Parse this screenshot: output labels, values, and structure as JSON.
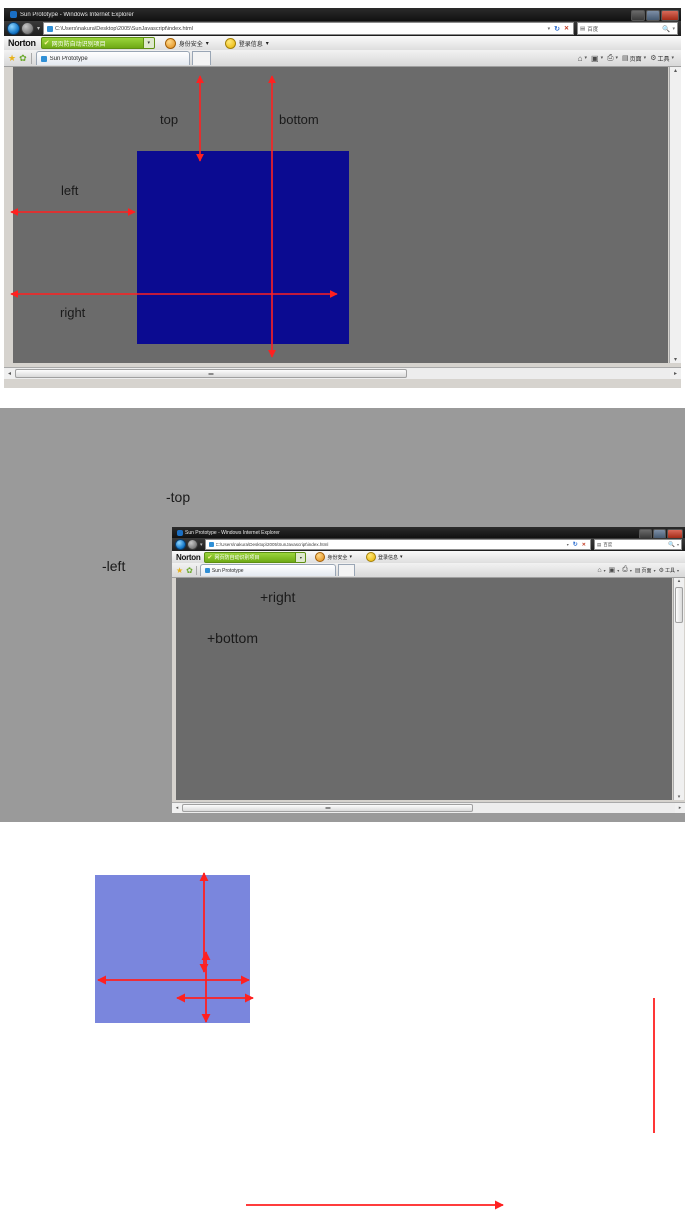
{
  "browser": {
    "title": "Sun Prototype - Windows Internet Explorer",
    "url": "C:\\Users\\nakura\\Desktop\\2005\\SunJavascript\\index.html",
    "search_placeholder": "百度",
    "tab_label": "Sun Prototype",
    "window_controls": {
      "minimize": "─",
      "maximize": "❐",
      "close": "✕"
    },
    "nav": {
      "back": "◀",
      "forward": "▶",
      "recent_pages": "▾",
      "refresh": "↻",
      "stop": "✕",
      "go": "→"
    },
    "norton": {
      "brand": "Norton",
      "status_text": "网页防自动识别项目",
      "status_caret": "▾",
      "tools": [
        {
          "label": "身份安全",
          "caret": "▾",
          "icon": "shield-icon"
        },
        {
          "label": "登录信息",
          "caret": "▾",
          "icon": "smiley-icon"
        }
      ]
    },
    "favorites": {
      "add_star": "★",
      "favorites_bar": "✿"
    },
    "command_bar": [
      {
        "icon": "home-icon",
        "label": "",
        "caret": "▾"
      },
      {
        "icon": "feeds-icon",
        "label": "",
        "caret": "▾"
      },
      {
        "icon": "print-icon",
        "label": "",
        "caret": "▾"
      },
      {
        "icon": "page-icon",
        "label": "页面",
        "caret": "▾"
      },
      {
        "icon": "tools-icon",
        "label": "工具",
        "caret": "▾"
      }
    ],
    "scrollbar": {
      "left_arrow": "◂",
      "right_arrow": "▸",
      "up_arrow": "▴",
      "down_arrow": "▾",
      "grip": "▪"
    }
  },
  "panel_top": {
    "name": "positive-offsets-example",
    "annotations": [
      {
        "key": "top",
        "label": "top"
      },
      {
        "key": "bottom",
        "label": "bottom"
      },
      {
        "key": "left",
        "label": "left"
      },
      {
        "key": "right",
        "label": "right"
      }
    ],
    "square_color": "#0b0b91",
    "background_color": "#6b6b6b",
    "arrow_color": "#ff2020"
  },
  "panel_bottom": {
    "name": "negative-offsets-example",
    "annotations": [
      {
        "key": "-top",
        "label": "-top"
      },
      {
        "key": "-left",
        "label": "-left"
      },
      {
        "key": "+right",
        "label": "+right"
      },
      {
        "key": "+bottom",
        "label": "+bottom"
      }
    ],
    "overlay_color": "rgba(40,60,200,.62)",
    "background_color": "#9a9a9a",
    "arrow_color": "#ff2020"
  }
}
